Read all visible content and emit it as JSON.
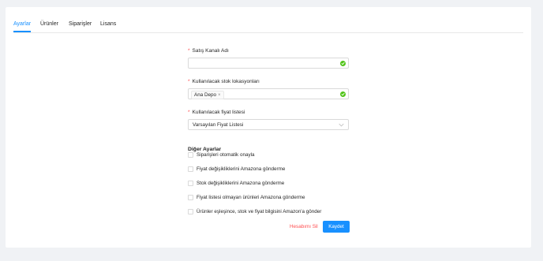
{
  "tabs": [
    {
      "label": "Ayarlar",
      "active": true
    },
    {
      "label": "Ürünler",
      "active": false
    },
    {
      "label": "Siparişler",
      "active": false
    },
    {
      "label": "Lisans",
      "active": false
    }
  ],
  "form": {
    "channel_name": {
      "label": "Satış Kanalı Adı",
      "value": ""
    },
    "stock_locations": {
      "label": "Kullanılacak stok lokasyonları",
      "tags": [
        "Ana Depo"
      ],
      "tag_close": "×"
    },
    "price_list": {
      "label": "Kullanılacak fiyat listesi",
      "value": "Varsayılan Fiyat Listesi"
    },
    "required_mark": "*"
  },
  "other_settings": {
    "title": "Diğer Ayarlar",
    "options": [
      {
        "label": "Siparişleri otomatik onayla",
        "checked": false
      },
      {
        "label": "Fiyat değişikliklerini Amazona gönderme",
        "checked": false
      },
      {
        "label": "Stok değişikliklerini Amazona gönderme",
        "checked": false
      },
      {
        "label": "Fiyat listesi olmayan ürünleri Amazona gönderme",
        "checked": false
      },
      {
        "label": "Ürünler eşleşince, stok ve fiyat bilgisini Amazon'a gönder",
        "checked": false
      }
    ]
  },
  "actions": {
    "delete_account": "Hesabımı Sil",
    "save": "Kaydet"
  },
  "colors": {
    "primary": "#1890ff",
    "danger": "#ff4d4f",
    "success": "#52c41a"
  },
  "icons": {
    "valid": "check-circle-icon",
    "dropdown": "chevron-down-icon",
    "tag_remove": "close-icon"
  }
}
